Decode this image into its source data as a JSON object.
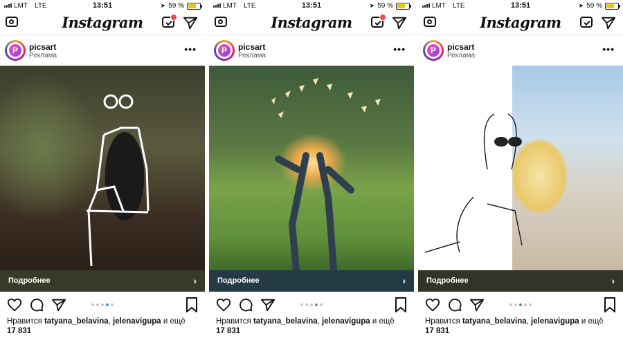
{
  "status_bar": {
    "carrier": "LMT",
    "network": "LTE",
    "time": "13:51",
    "battery": "59 %",
    "battery_level": 0.59
  },
  "app": {
    "name": "Instagram"
  },
  "icons": [
    "camera-icon",
    "igtv-icon",
    "direct-send-icon",
    "more-icon",
    "heart-icon",
    "comment-icon",
    "share-icon",
    "bookmark-icon"
  ],
  "colors": {
    "notification": "#ed4956",
    "carousel_active": "#3897f0"
  },
  "posts": [
    {
      "username": "picsart",
      "sponsored_label": "Реклама",
      "cta_label": "Подробнее",
      "cta_arrow": "›",
      "cta_color": "#3a3a2a",
      "carousel": {
        "total": 5,
        "active": 4
      },
      "likes_prefix": "Нравится ",
      "liker1": "tatyana_belavina",
      "sep": ", ",
      "liker2": "jelenavigupa",
      "likes_suffix": " и ещё",
      "likes_count": "17 831"
    },
    {
      "username": "picsart",
      "sponsored_label": "Реклама",
      "cta_label": "Подробнее",
      "cta_arrow": "›",
      "cta_color": "#243a44",
      "carousel": {
        "total": 5,
        "active": 4
      },
      "likes_prefix": "Нравится ",
      "liker1": "tatyana_belavina",
      "sep": ", ",
      "liker2": "jelenavigupa",
      "likes_suffix": " и ещё",
      "likes_count": "17 831"
    },
    {
      "username": "picsart",
      "sponsored_label": "Реклама",
      "cta_label": "Подробнее",
      "cta_arrow": "›",
      "cta_color": "#333328",
      "carousel": {
        "total": 5,
        "active": 3
      },
      "likes_prefix": "Нравится ",
      "liker1": "tatyana_belavina",
      "sep": ", ",
      "liker2": "jelenavigupa",
      "likes_suffix": " и ещё",
      "likes_count": "17 831"
    }
  ]
}
